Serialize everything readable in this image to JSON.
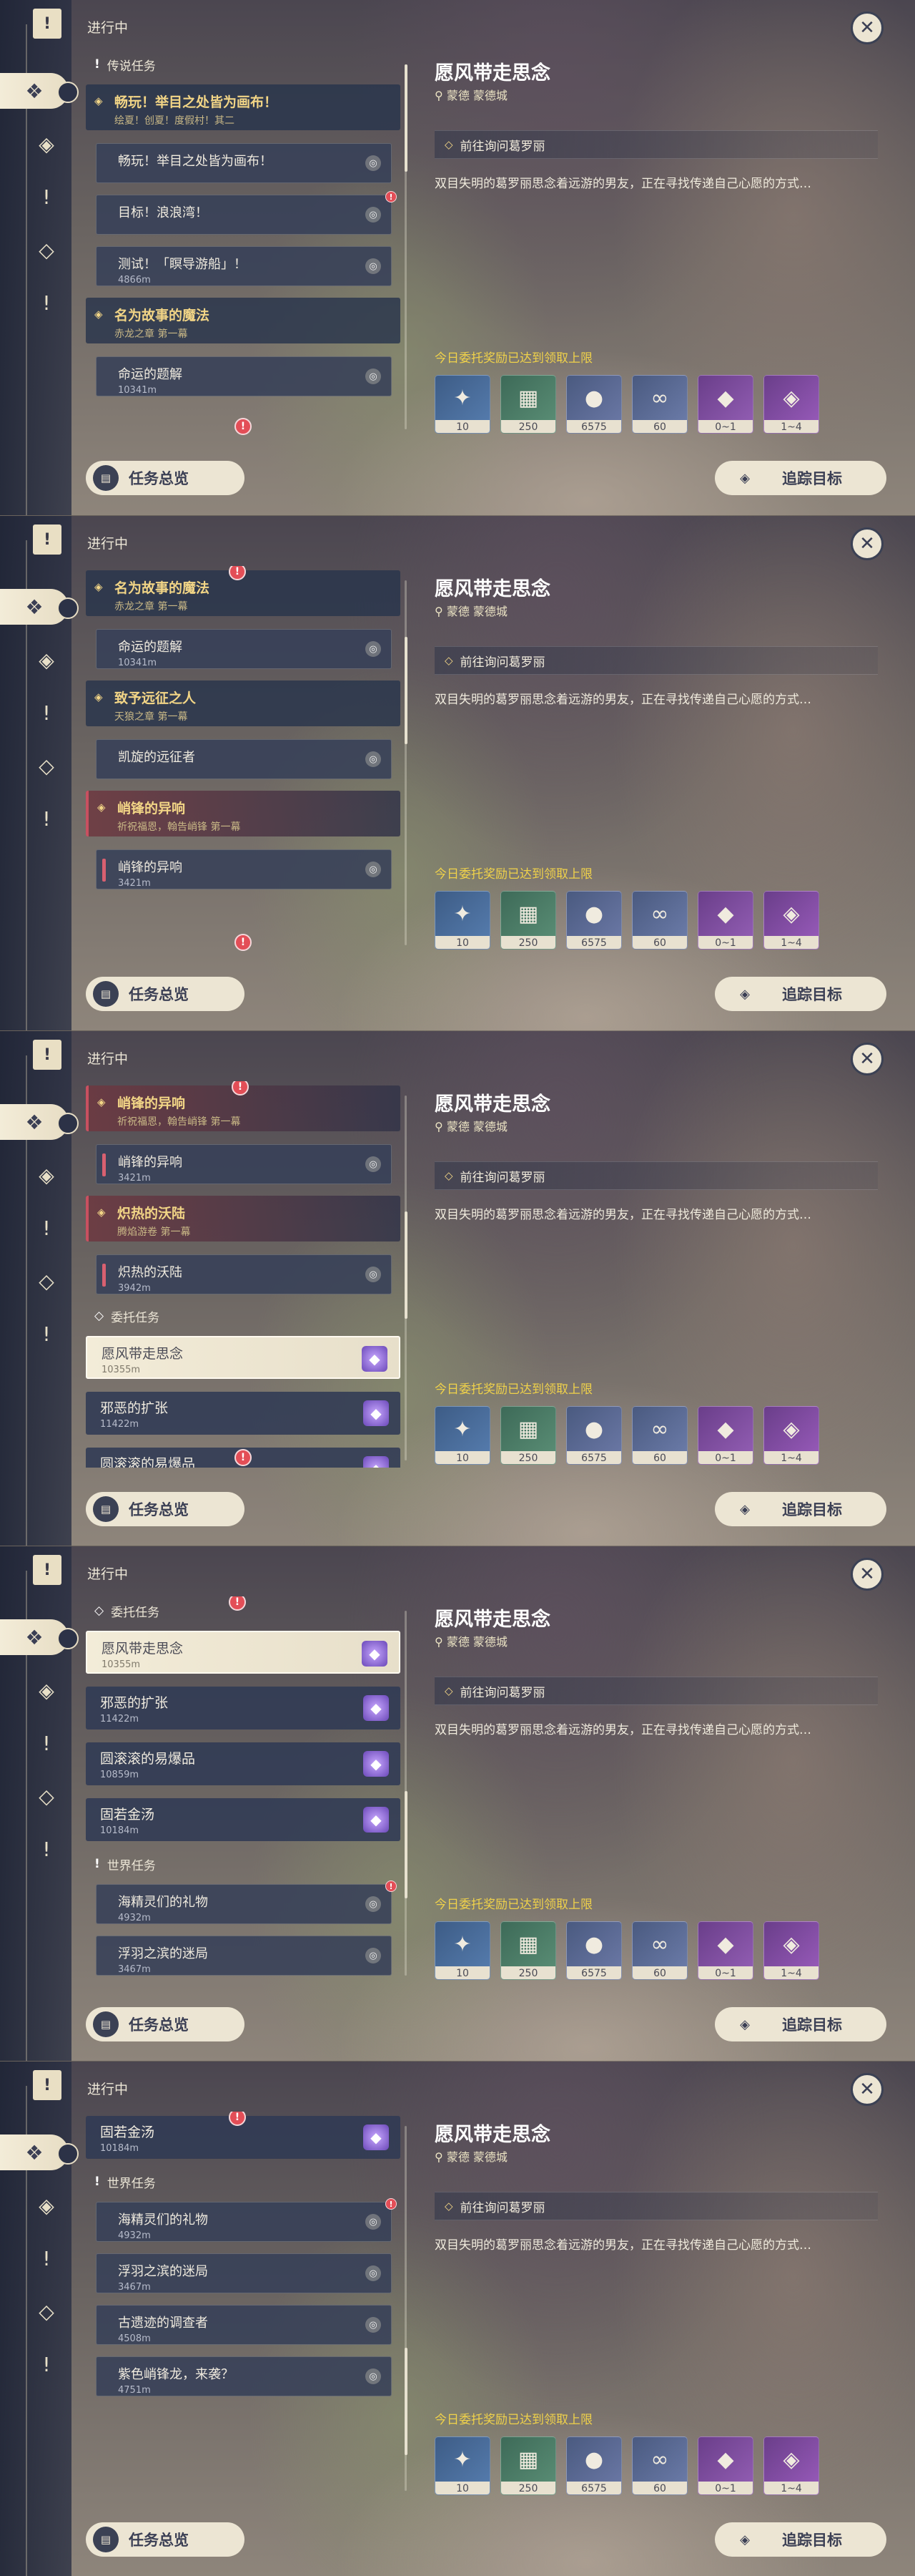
{
  "header": "进行中",
  "detail": {
    "title": "愿风带走思念",
    "location": "蒙德 蒙德城",
    "objective": "前往询问葛罗丽",
    "description": "双目失明的葛罗丽思念着远游的男友，正在寻找传递自己心愿的方式…",
    "limit_text": "今日委托奖励已达到领取上限",
    "rewards": [
      {
        "icon": "primogem-icon",
        "glyph": "✦",
        "count": "10"
      },
      {
        "icon": "adventure-exp-icon",
        "glyph": "▦",
        "count": "250"
      },
      {
        "icon": "mora-icon",
        "glyph": "●",
        "count": "6575"
      },
      {
        "icon": "companionship-exp-icon",
        "glyph": "∞",
        "count": "60"
      },
      {
        "icon": "ore-icon",
        "glyph": "◆",
        "count": "0~1"
      },
      {
        "icon": "crystal-icon",
        "glyph": "◈",
        "count": "1~4"
      }
    ]
  },
  "buttons": {
    "overview": "任务总览",
    "track": "追踪目标"
  },
  "icons": {
    "close": "close-icon",
    "alert": "!",
    "pin": "◎",
    "diamond": "◇",
    "gem": "◆"
  },
  "colors": {
    "accent": "#f2d586",
    "alert": "#e34e57",
    "limit": "#f0d24a",
    "panel": "#ece5d3"
  },
  "shots": [
    {
      "scroll": 0.0,
      "active_nav": 1,
      "show_header": false,
      "list": [
        {
          "kind": "cat",
          "label": "传说任务"
        },
        {
          "kind": "head",
          "title": "畅玩！举目之处皆为画布！",
          "subtitle": "绘夏！创夏！度假村！其二"
        },
        {
          "kind": "sub",
          "title": "畅玩！举目之处皆为画布！",
          "dist": ""
        },
        {
          "kind": "sub",
          "title": "目标！浪浪湾！",
          "dist": "",
          "alert": true
        },
        {
          "kind": "sub",
          "title": "测试！「瞑导游船」！",
          "dist": "4866m"
        },
        {
          "kind": "head",
          "title": "名为故事的魔法",
          "subtitle": "赤龙之章 第一幕"
        },
        {
          "kind": "sub",
          "title": "命运的题解",
          "dist": "10341m"
        }
      ],
      "alerts_bottom": true
    },
    {
      "scroll": 0.22,
      "active_nav": 1,
      "show_header": true,
      "list": [
        {
          "kind": "head",
          "title": "名为故事的魔法",
          "subtitle": "赤龙之章 第一幕",
          "alert_top": true
        },
        {
          "kind": "sub",
          "title": "命运的题解",
          "dist": "10341m"
        },
        {
          "kind": "head",
          "title": "致予远征之人",
          "subtitle": "天狼之章 第一幕"
        },
        {
          "kind": "sub",
          "title": "凯旋的远征者",
          "dist": ""
        },
        {
          "kind": "head",
          "title": "峭锋的异响",
          "subtitle": "祈祝福恩，翰告峭锋 第一幕",
          "red": true
        },
        {
          "kind": "sub",
          "title": "峭锋的异响",
          "dist": "3421m",
          "red": true
        }
      ],
      "alerts_bottom": true
    },
    {
      "scroll": 0.45,
      "active_nav": 1,
      "show_header": true,
      "list": [
        {
          "kind": "head",
          "title": "峭锋的异响",
          "subtitle": "祈祝福恩，翰告峭锋 第一幕",
          "red": true,
          "alert_top": true
        },
        {
          "kind": "sub",
          "title": "峭锋的异响",
          "dist": "3421m",
          "red": true
        },
        {
          "kind": "head",
          "title": "炽热的沃陆",
          "subtitle": "腾焰游卷 第一幕",
          "red": true
        },
        {
          "kind": "sub",
          "title": "炽热的沃陆",
          "dist": "3942m",
          "red": true
        },
        {
          "kind": "cat",
          "label": "委托任务",
          "diamond": true
        },
        {
          "kind": "comm",
          "title": "愿风带走思念",
          "dist": "10355m",
          "sel": true
        },
        {
          "kind": "comm",
          "title": "邪恶的扩张",
          "dist": "11422m"
        },
        {
          "kind": "comm",
          "title": "圆滚滚的易爆品",
          "dist": "10859m"
        }
      ],
      "alerts_bottom": true
    },
    {
      "scroll": 0.7,
      "active_nav": 1,
      "show_header": true,
      "list": [
        {
          "kind": "cat",
          "label": "委托任务",
          "diamond": true,
          "alert_top": true
        },
        {
          "kind": "comm",
          "title": "愿风带走思念",
          "dist": "10355m",
          "sel": true
        },
        {
          "kind": "comm",
          "title": "邪恶的扩张",
          "dist": "11422m"
        },
        {
          "kind": "comm",
          "title": "圆滚滚的易爆品",
          "dist": "10859m"
        },
        {
          "kind": "comm",
          "title": "固若金汤",
          "dist": "10184m"
        },
        {
          "kind": "cat",
          "label": "世界任务"
        },
        {
          "kind": "sub",
          "title": "海精灵们的礼物",
          "dist": "4932m",
          "alert": true
        },
        {
          "kind": "sub",
          "title": "浮羽之滨的迷局",
          "dist": "3467m"
        },
        {
          "kind": "sub",
          "title": "古遗迹的调查者",
          "dist": "4508m"
        }
      ],
      "alerts_bottom": false
    },
    {
      "scroll": 0.86,
      "active_nav": 1,
      "show_header": true,
      "list": [
        {
          "kind": "comm",
          "title": "固若金汤",
          "dist": "10184m",
          "alert_top": true
        },
        {
          "kind": "cat",
          "label": "世界任务"
        },
        {
          "kind": "sub",
          "title": "海精灵们的礼物",
          "dist": "4932m",
          "alert": true
        },
        {
          "kind": "sub",
          "title": "浮羽之滨的迷局",
          "dist": "3467m"
        },
        {
          "kind": "sub",
          "title": "古遗迹的调查者",
          "dist": "4508m"
        },
        {
          "kind": "sub",
          "title": "紫色峭锋龙，来袭？",
          "dist": "4751m"
        }
      ],
      "alerts_bottom": false
    }
  ]
}
